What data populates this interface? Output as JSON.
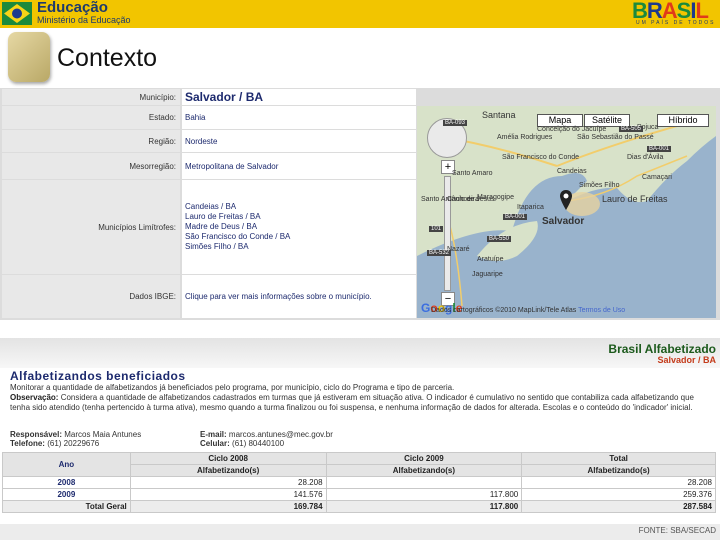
{
  "header": {
    "gov_title": "Educação",
    "gov_subtitle": "Ministério da Educação",
    "brasil_logo": "BRASIL",
    "brasil_tagline": "UM PAÍS DE TODOS",
    "colors": {
      "bar": "#f2c500",
      "blue": "#1d3a6e"
    }
  },
  "page_title": "Contexto",
  "info": {
    "municipio_label": "Município:",
    "municipio_value": "Salvador / BA",
    "estado_label": "Estado:",
    "estado_value": "Bahia",
    "regiao_label": "Região:",
    "regiao_value": "Nordeste",
    "mesorregiao_label": "Mesorregião:",
    "mesorregiao_value": "Metropolitana de Salvador",
    "limitrofes_label": "Municípios Limítrofes:",
    "limitrofes": [
      "Candeias / BA",
      "Lauro de Freitas / BA",
      "Madre de Deus / BA",
      "São Francisco do Conde / BA",
      "Simões Filho / BA"
    ],
    "ibge_label": "Dados IBGE:",
    "ibge_value": "Clique para ver mais informações sobre o município."
  },
  "map": {
    "buttons": [
      "Mapa",
      "Satélite",
      "Híbrido"
    ],
    "labels": {
      "santana": "Santana",
      "conceicao": "Conceição do Jacuípe",
      "amelia": "Amélia Rodrigues",
      "sao_sebastiao": "São Sebastião do Passé",
      "pojuca": "Pojuca",
      "dias": "Dias d'Ávila",
      "camacari": "Camaçari",
      "candeias": "Candeias",
      "sao_francisco": "São Francisco do Conde",
      "santo_amaro": "Santo Amaro",
      "cachoeira": "Cachoeira",
      "maragogipe": "Maragogipe",
      "simoes": "Simões Filho",
      "lauro": "Lauro de Freitas",
      "santo_antonio": "Santo Antônio de Jesus",
      "itaparica": "Itaparica",
      "salvador": "Salvador",
      "nazare": "Nazaré",
      "jaguaripe": "Jaguaripe",
      "aratuipe": "Aratuípe"
    },
    "roads": [
      "BA-093",
      "BA-505",
      "BA-001",
      "BA-550",
      "BA-532",
      "101",
      "BA-001"
    ],
    "footer": "Dados cartográficos ©2010 MapLink/Tele Atlas",
    "terms": "Termos de Uso",
    "google": "Google"
  },
  "program": {
    "brand": "Brasil Alfabetizado",
    "location": "Salvador / BA",
    "section_title": "Alfabetizandos beneficiados",
    "description": "Monitorar a quantidade de alfabetizandos já beneficiados pelo programa, por município, ciclo do Programa e tipo de parceria.",
    "obs_label": "Observação:",
    "observation": "Considera a quantidade de alfabetizandos cadastrados em turmas que já estiveram em situação ativa. O indicador é cumulativo no sentido que contabiliza cada alfabetizando que tenha sido atendido (tenha pertencido à turma ativa), mesmo quando a turma finalizou ou foi suspensa, e nenhuma informação de dados for alterada. Escolas e o conteúdo do 'indicador' inicial.",
    "resp_label": "Responsável:",
    "resp_value": "Marcos Maia Antunes",
    "tel_label": "Telefone:",
    "tel_value": "(61) 20229676",
    "email_label": "E-mail:",
    "email_value": "marcos.antunes@mec.gov.br",
    "cel_label": "Celular:",
    "cel_value": "(61) 80440100"
  },
  "table": {
    "col_ano": "Ano",
    "col_ciclo2008": "Ciclo 2008",
    "col_ciclo2009": "Ciclo 2009",
    "col_total": "Total",
    "sub_alf": "Alfabetizando(s)",
    "rows": [
      {
        "ano": "2008",
        "c2008": "28.208",
        "c2009": "",
        "total": "28.208"
      },
      {
        "ano": "2009",
        "c2008": "141.576",
        "c2009": "117.800",
        "total": "259.376"
      }
    ],
    "total_label": "Total Geral",
    "total": {
      "c2008": "169.784",
      "c2009": "117.800",
      "total": "287.584"
    }
  },
  "fonte": "FONTE: SBA/SECAD"
}
